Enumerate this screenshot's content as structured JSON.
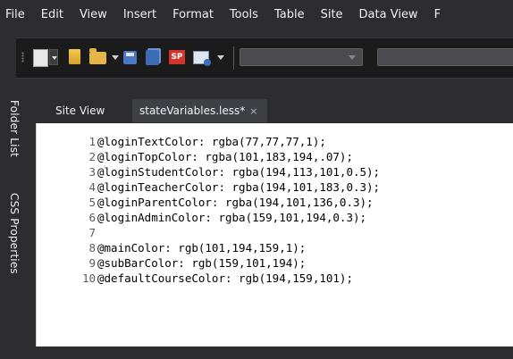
{
  "menu": [
    "File",
    "Edit",
    "View",
    "Insert",
    "Format",
    "Tools",
    "Table",
    "Site",
    "Data View",
    "F"
  ],
  "toolbar": {
    "icons": [
      "new-page-icon",
      "notes-icon",
      "open-folder-icon",
      "save-icon",
      "save-all-icon",
      "sharepoint-icon",
      "preview-icon"
    ],
    "style_combo_value": "",
    "font_combo_value": ""
  },
  "side_panels": {
    "folder_list": "Folder List",
    "css_properties": "CSS Properties"
  },
  "tabs": {
    "site_view": "Site View",
    "active": "stateVariables.less*",
    "close_glyph": "×"
  },
  "editor": {
    "lines": [
      {
        "n": "1",
        "code": "@loginTextColor: rgba(77,77,77,1);"
      },
      {
        "n": "2",
        "code": "@loginTopColor: rgba(101,183,194,.07);"
      },
      {
        "n": "3",
        "code": "@loginStudentColor: rgba(194,113,101,0.5);"
      },
      {
        "n": "4",
        "code": "@loginTeacherColor: rgba(194,101,183,0.3);"
      },
      {
        "n": "5",
        "code": "@loginParentColor: rgba(194,101,136,0.3);"
      },
      {
        "n": "6",
        "code": "@loginAdminColor: rgba(159,101,194,0.3);"
      },
      {
        "n": "7",
        "code": ""
      },
      {
        "n": "8",
        "code": "@mainColor: rgb(101,194,159,1);"
      },
      {
        "n": "9",
        "code": "@subBarColor: rgb(159,101,194);"
      },
      {
        "n": "10",
        "code": "@defaultCourseColor: rgb(194,159,101);"
      }
    ]
  },
  "colors": {
    "chrome_bg": "#2d2d30",
    "active_tab": "#3f3f46",
    "editor_bg": "#ffffff"
  }
}
